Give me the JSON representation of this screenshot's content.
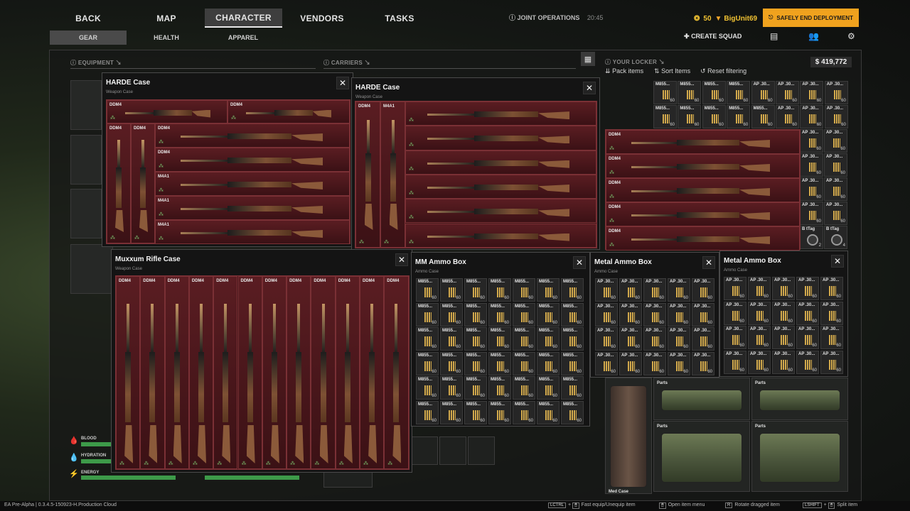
{
  "nav": {
    "tabs": [
      "BACK",
      "MAP",
      "CHARACTER",
      "VENDORS",
      "TASKS"
    ],
    "active_tab": "CHARACTER",
    "subtabs": [
      "GEAR",
      "HEALTH",
      "APPAREL"
    ],
    "active_subtab": "GEAR"
  },
  "joint_operations": {
    "label": "JOINT OPERATIONS",
    "time": "20:45"
  },
  "user": {
    "level": "50",
    "name": "BigUnit69"
  },
  "end_deployment_label": "SAFELY END DEPLOYMENT",
  "create_squad_label": "CREATE SQUAD",
  "sections": {
    "equipment": "EQUIPMENT",
    "carriers": "CARRIERS",
    "locker": "YOUR LOCKER"
  },
  "locker": {
    "money": "$ 419,772",
    "actions": [
      "Pack items",
      "Sort Items",
      "Reset filtering"
    ],
    "ammo_rows": [
      [
        "M855...",
        "M855...",
        "M855...",
        "M855...",
        "AP .30...",
        "AP .30...",
        "AP .30...",
        "AP .30..."
      ],
      [
        "M855...",
        "M855...",
        "M855...",
        "M855...",
        "M855...",
        "AP .30...",
        "AP .30...",
        "AP .30..."
      ]
    ],
    "side_ammo_label": "AP .30...",
    "ammo_count": "60",
    "tags": [
      {
        "label": "B tTag",
        "count": "2"
      },
      {
        "label": "B tTag",
        "count": "4"
      }
    ],
    "weapons": [
      "DDM4",
      "DDM4",
      "DDM4",
      "DDM4",
      "DDM4"
    ],
    "crates": [
      "Parts",
      "Parts",
      "Parts",
      "Med Case",
      "Parts"
    ]
  },
  "stats": [
    {
      "label": "BLOOD",
      "icon": "blood-drop-icon",
      "fill": 1.0
    },
    {
      "label": "HYDRATION",
      "icon": "water-drop-icon",
      "fill": 1.0
    },
    {
      "label": "ENERGY",
      "icon": "lightning-icon",
      "fill": 1.0
    }
  ],
  "windows": {
    "harde1": {
      "title": "HARDE Case",
      "subtitle": "Weapon Case",
      "top_labels": [
        "DDM4",
        "DDM4"
      ],
      "vertical": [
        "DDM4",
        "DDM4"
      ],
      "rows": [
        "DDM4",
        "DDM4",
        "M4A1",
        "M4A1",
        "M4A1"
      ]
    },
    "harde2": {
      "title": "HARDE Case",
      "subtitle": "Weapon Case",
      "vertical": [
        "DDM4",
        "M4A1"
      ],
      "rows": [
        "",
        "",
        "",
        "",
        "",
        ""
      ]
    },
    "rifle": {
      "title": "Muxxum Rifle Case",
      "subtitle": "Weapon Case",
      "columns": [
        "DDM4",
        "DDM4",
        "DDM4",
        "DDM4",
        "DDM4",
        "DDM4",
        "DDM4",
        "DDM4",
        "DDM4",
        "DDM4",
        "DDM4",
        "DDM4"
      ]
    },
    "mm_ammo": {
      "title": "MM Ammo Box",
      "subtitle": "Ammo Case",
      "cell_label": "M855...",
      "count": "60",
      "cols": 7,
      "rows": 6
    },
    "metal1": {
      "title": "Metal Ammo Box",
      "subtitle": "Ammo Case",
      "cell_label": "AP .30...",
      "count": "60",
      "cols": 5,
      "rows": 4
    },
    "metal2": {
      "title": "Metal Ammo Box",
      "subtitle": "Ammo Case",
      "cell_label": "AP .30...",
      "count": "60",
      "cols": 5,
      "rows": 4
    }
  },
  "bottom": {
    "version": "EA Pre-Alpha | 0.3.4.5-150923-H.Production Cloud",
    "hints": [
      {
        "key": "LCTRL",
        "label": "Fast equip/Unequip item"
      },
      {
        "key": "M",
        "label": "Open item menu"
      },
      {
        "key": "R",
        "label": "Rotate dragged item"
      },
      {
        "key": "LSHIFT",
        "label": "Split item"
      }
    ]
  },
  "colors": {
    "accent": "#f0a21e",
    "case_bg": "#3e1416",
    "stat_bar": "#3d9a49"
  }
}
